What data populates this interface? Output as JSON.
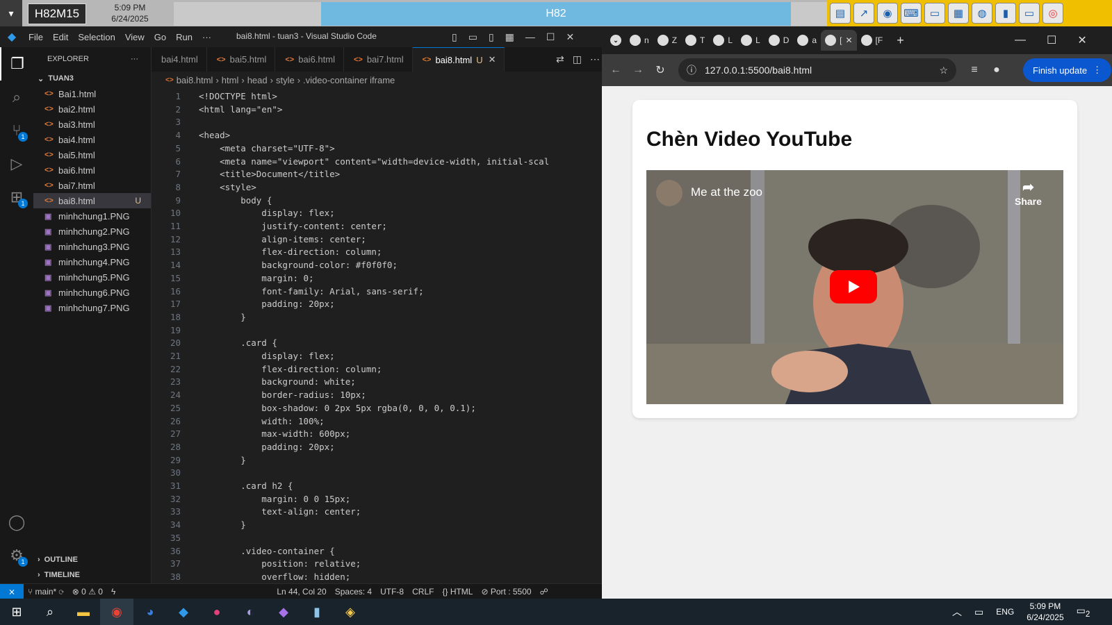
{
  "topbar": {
    "host": "H82M15",
    "time": "5:09 PM",
    "date": "6/24/2025",
    "title": "H82"
  },
  "vscode": {
    "menu": [
      "File",
      "Edit",
      "Selection",
      "View",
      "Go",
      "Run",
      "···"
    ],
    "window_title": "bai8.html - tuan3 - Visual Studio Code",
    "explorer_label": "EXPLORER",
    "folder": "TUAN3",
    "files": [
      {
        "name": "Bai1.html",
        "type": "html"
      },
      {
        "name": "bai2.html",
        "type": "html"
      },
      {
        "name": "bai3.html",
        "type": "html"
      },
      {
        "name": "bai4.html",
        "type": "html"
      },
      {
        "name": "bai5.html",
        "type": "html"
      },
      {
        "name": "bai6.html",
        "type": "html"
      },
      {
        "name": "bai7.html",
        "type": "html"
      },
      {
        "name": "bai8.html",
        "type": "html",
        "status": "U"
      },
      {
        "name": "minhchung1.PNG",
        "type": "png"
      },
      {
        "name": "minhchung2.PNG",
        "type": "png"
      },
      {
        "name": "minhchung3.PNG",
        "type": "png"
      },
      {
        "name": "minhchung4.PNG",
        "type": "png"
      },
      {
        "name": "minhchung5.PNG",
        "type": "png"
      },
      {
        "name": "minhchung6.PNG",
        "type": "png"
      },
      {
        "name": "minhchung7.PNG",
        "type": "png"
      }
    ],
    "outline": "OUTLINE",
    "timeline": "TIMELINE",
    "tabs": [
      "bai4.html",
      "bai5.html",
      "bai6.html",
      "bai7.html",
      "bai8.html"
    ],
    "active_tab_status": "U",
    "breadcrumb": [
      "bai8.html",
      "html",
      "head",
      "style",
      ".video-container iframe"
    ],
    "code_lines": [
      "<!DOCTYPE html>",
      "<html lang=\"en\">",
      "",
      "<head>",
      "    <meta charset=\"UTF-8\">",
      "    <meta name=\"viewport\" content=\"width=device-width, initial-scal",
      "    <title>Document</title>",
      "    <style>",
      "        body {",
      "            display: flex;",
      "            justify-content: center;",
      "            align-items: center;",
      "            flex-direction: column;",
      "            background-color: #f0f0f0;",
      "            margin: 0;",
      "            font-family: Arial, sans-serif;",
      "            padding: 20px;",
      "        }",
      "",
      "        .card {",
      "            display: flex;",
      "            flex-direction: column;",
      "            background: white;",
      "            border-radius: 10px;",
      "            box-shadow: 0 2px 5px rgba(0, 0, 0, 0.1);",
      "            width: 100%;",
      "            max-width: 600px;",
      "            padding: 20px;",
      "        }",
      "",
      "        .card h2 {",
      "            margin: 0 0 15px;",
      "            text-align: center;",
      "        }",
      "",
      "        .video-container {",
      "            position: relative;",
      "            overflow: hidden;"
    ],
    "status": {
      "branch": "main*",
      "errors": "0",
      "warnings": "0",
      "position": "Ln 44, Col 20",
      "spaces": "Spaces: 4",
      "encoding": "UTF-8",
      "eol": "CRLF",
      "language": "HTML",
      "port": "Port : 5500"
    }
  },
  "chrome": {
    "tabs": [
      {
        "icon": "github-icon",
        "label": "n"
      },
      {
        "icon": "zalo-icon",
        "label": "Z"
      },
      {
        "icon": "sheets-icon",
        "label": "T"
      },
      {
        "icon": "github-icon",
        "label": "L"
      },
      {
        "icon": "docs-icon",
        "label": "L"
      },
      {
        "icon": "globe-icon",
        "label": "D"
      },
      {
        "icon": "google-icon",
        "label": "a"
      },
      {
        "icon": "page-icon",
        "label": "[",
        "active": true
      },
      {
        "icon": "audio-icon",
        "label": "[F"
      }
    ],
    "url": "127.0.0.1:5500/bai8.html",
    "finish_update": "Finish update",
    "page_heading": "Chèn Video YouTube",
    "video_title": "Me at the zoo",
    "share_label": "Share"
  },
  "taskbar": {
    "lang": "ENG",
    "time": "5:09 PM",
    "date": "6/24/2025",
    "notifications": "2"
  }
}
